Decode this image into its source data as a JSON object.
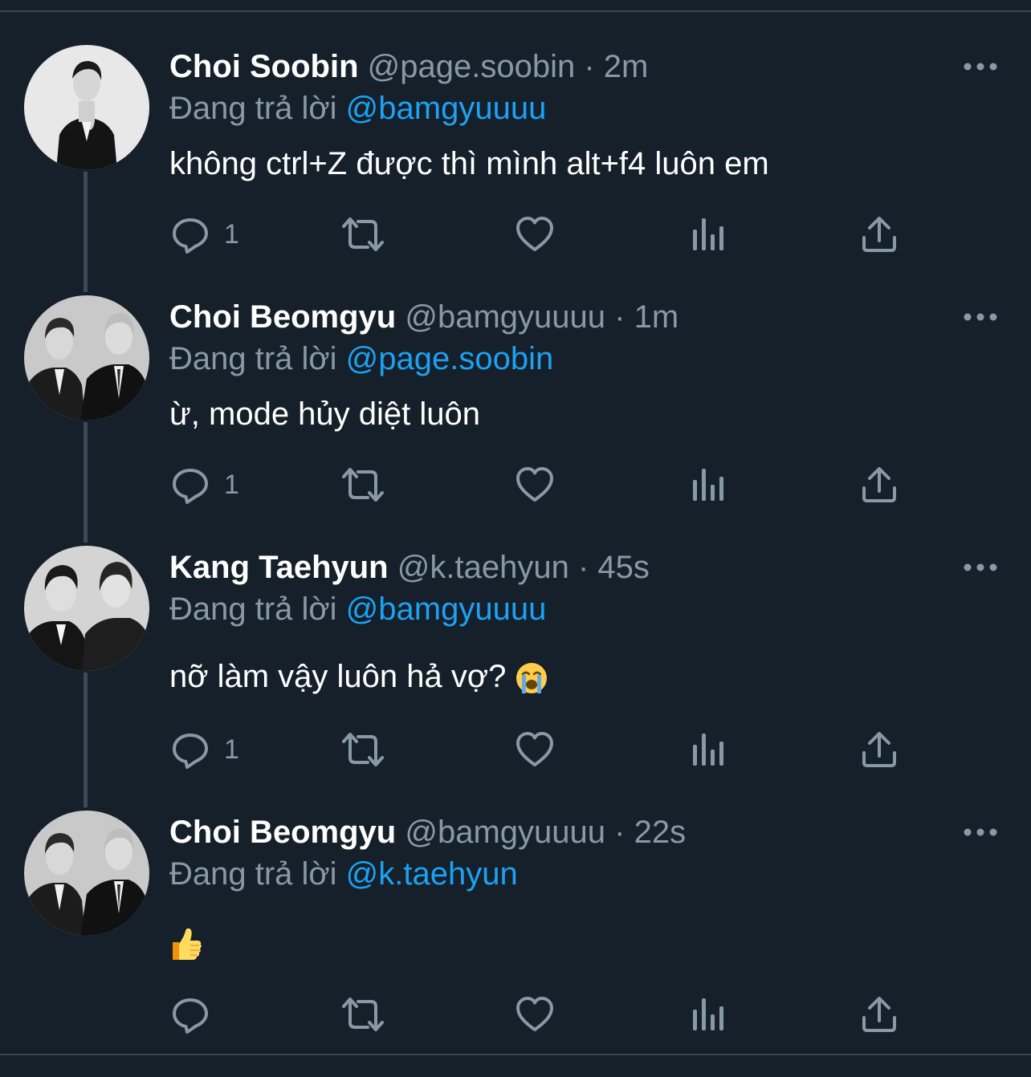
{
  "colors": {
    "background": "#15202b",
    "text": "#ffffff",
    "muted": "#8899a6",
    "mention": "#1da1f2",
    "divider": "#38444d"
  },
  "tweets": [
    {
      "name": "Choi Soobin",
      "handle": "@page.soobin",
      "sep": "·",
      "time": "2m",
      "replying_prefix": "Đang trả lời",
      "replying_to": "@bamgyuuuu",
      "text": "không ctrl+Z được thì mình alt+f4 luôn em",
      "reply_count": "1",
      "avatar_icon": "single-person-avatar"
    },
    {
      "name": "Choi Beomgyu",
      "handle": "@bamgyuuuu",
      "sep": "·",
      "time": "1m",
      "replying_prefix": "Đang trả lời",
      "replying_to": "@page.soobin",
      "text": "ừ, mode hủy diệt luôn",
      "reply_count": "1",
      "avatar_icon": "two-person-avatar"
    },
    {
      "name": "Kang Taehyun",
      "handle": "@k.taehyun",
      "sep": "·",
      "time": "45s",
      "replying_prefix": "Đang trả lời",
      "replying_to": "@bamgyuuuu",
      "text": "nỡ làm vậy luôn hả vợ?",
      "emoji": "loudly-crying-face-emoji",
      "reply_count": "1",
      "avatar_icon": "two-person-avatar"
    },
    {
      "name": "Choi Beomgyu",
      "handle": "@bamgyuuuu",
      "sep": "·",
      "time": "22s",
      "replying_prefix": "Đang trả lời",
      "replying_to": "@k.taehyun",
      "text": "",
      "emoji": "thumbs-up-emoji",
      "reply_count": "",
      "avatar_icon": "two-person-avatar"
    }
  ]
}
